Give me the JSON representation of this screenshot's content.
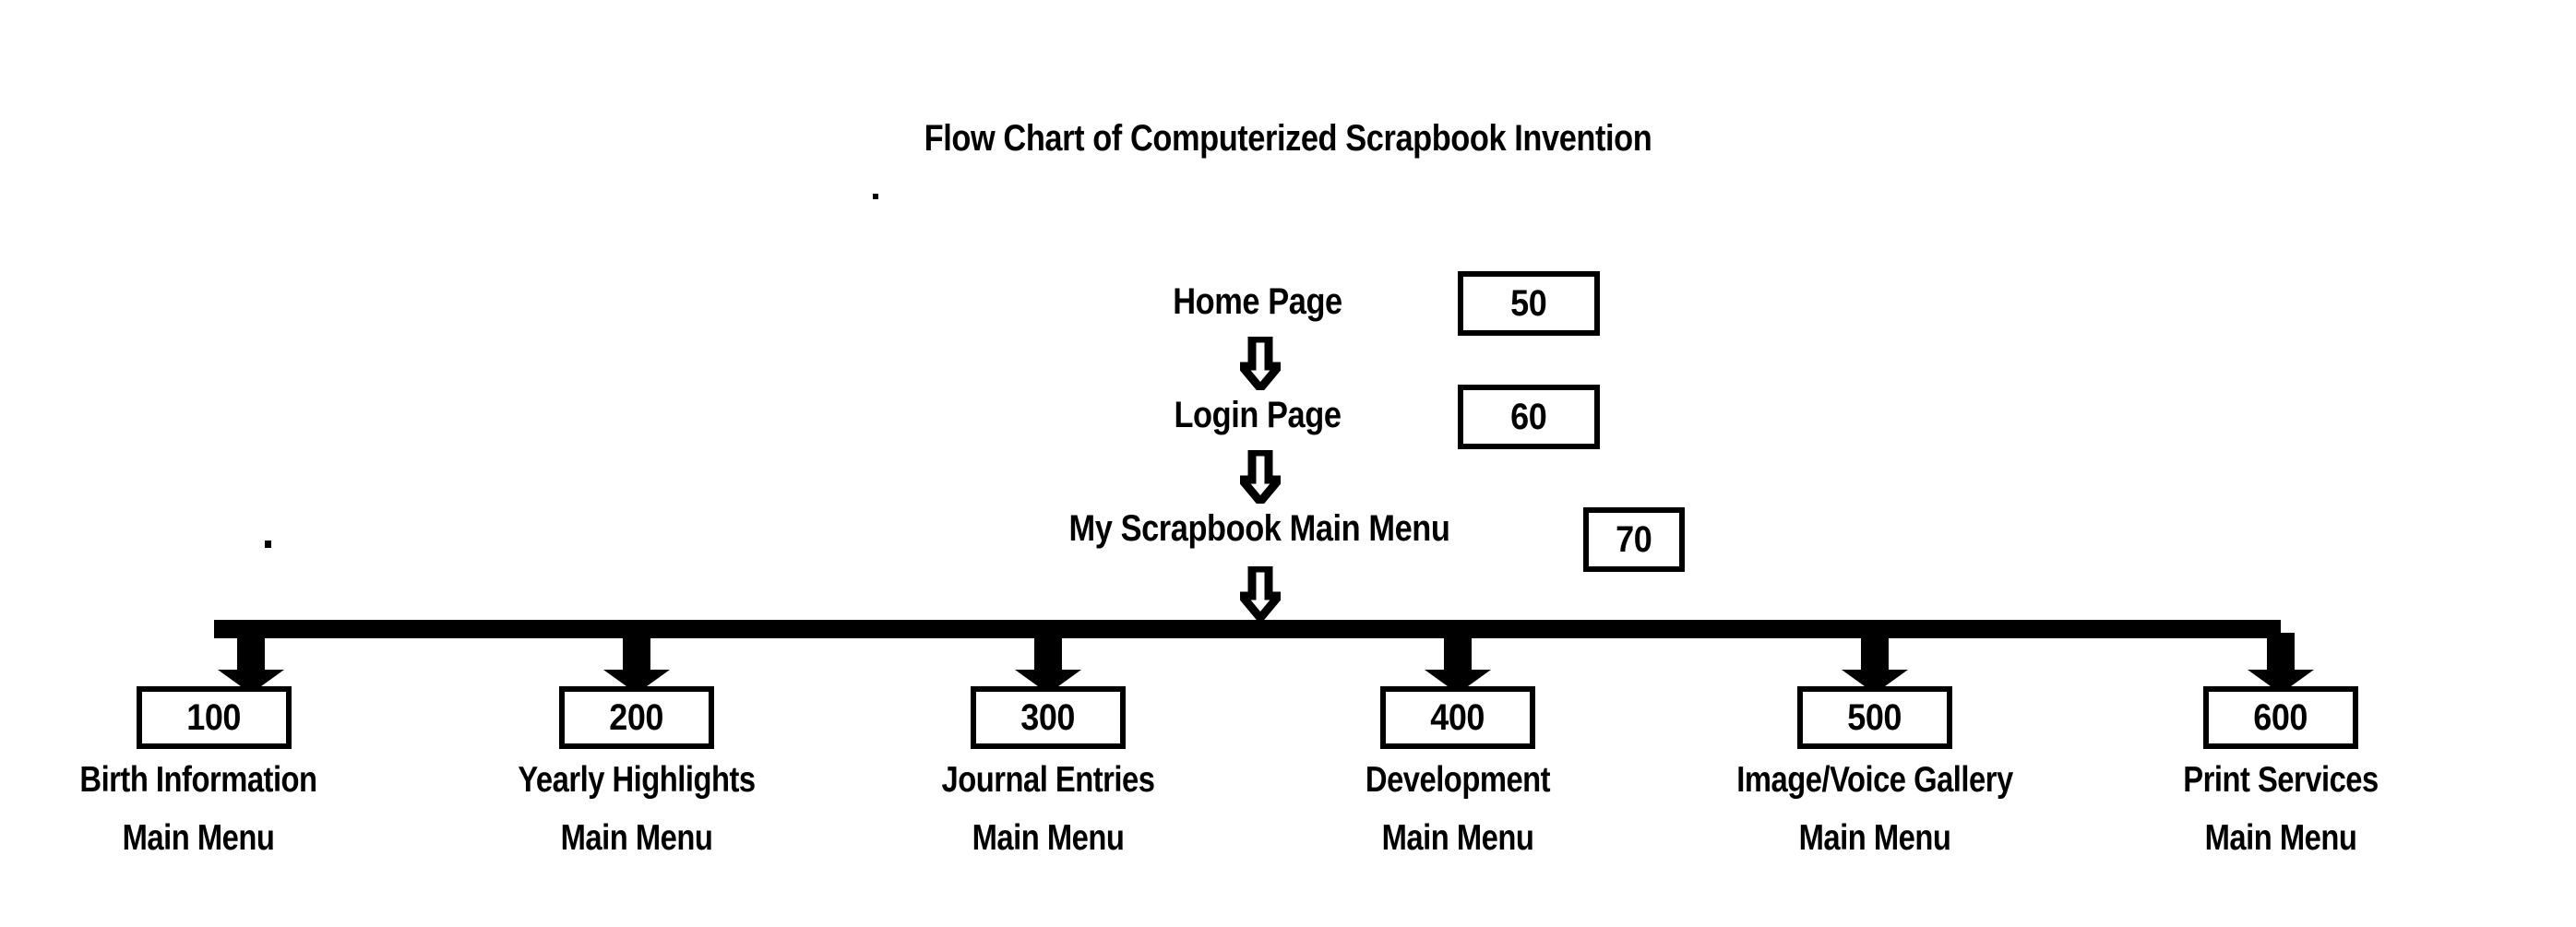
{
  "figure": {
    "title": "Flow Chart of Computerized Scrapbook Invention",
    "type": "flowchart",
    "ink_color": "#000000",
    "background_color": "#ffffff"
  },
  "flow": {
    "levels": [
      {
        "label": "Home Page",
        "ref": "50"
      },
      {
        "label": "Login Page",
        "ref": "60"
      },
      {
        "label": "My Scrapbook Main Menu",
        "ref": "70"
      }
    ]
  },
  "branches": [
    {
      "ref": "100",
      "caption_line1": "Birth Information",
      "caption_line2": "Main Menu"
    },
    {
      "ref": "200",
      "caption_line1": "Yearly Highlights",
      "caption_line2": "Main Menu"
    },
    {
      "ref": "300",
      "caption_line1": "Journal Entries",
      "caption_line2": "Main Menu"
    },
    {
      "ref": "400",
      "caption_line1": "Development",
      "caption_line2": "Main Menu"
    },
    {
      "ref": "500",
      "caption_line1": "Image/Voice Gallery",
      "caption_line2": "Main Menu"
    },
    {
      "ref": "600",
      "caption_line1": "Print Services",
      "caption_line2": "Main Menu"
    }
  ],
  "connectors": {
    "home_to_login": "down-arrow-icon",
    "login_to_mainmenu": "down-arrow-icon",
    "mainmenu_to_bus": "down-arrow-icon",
    "bus_to_branch": "solid-down-arrow-icon"
  }
}
